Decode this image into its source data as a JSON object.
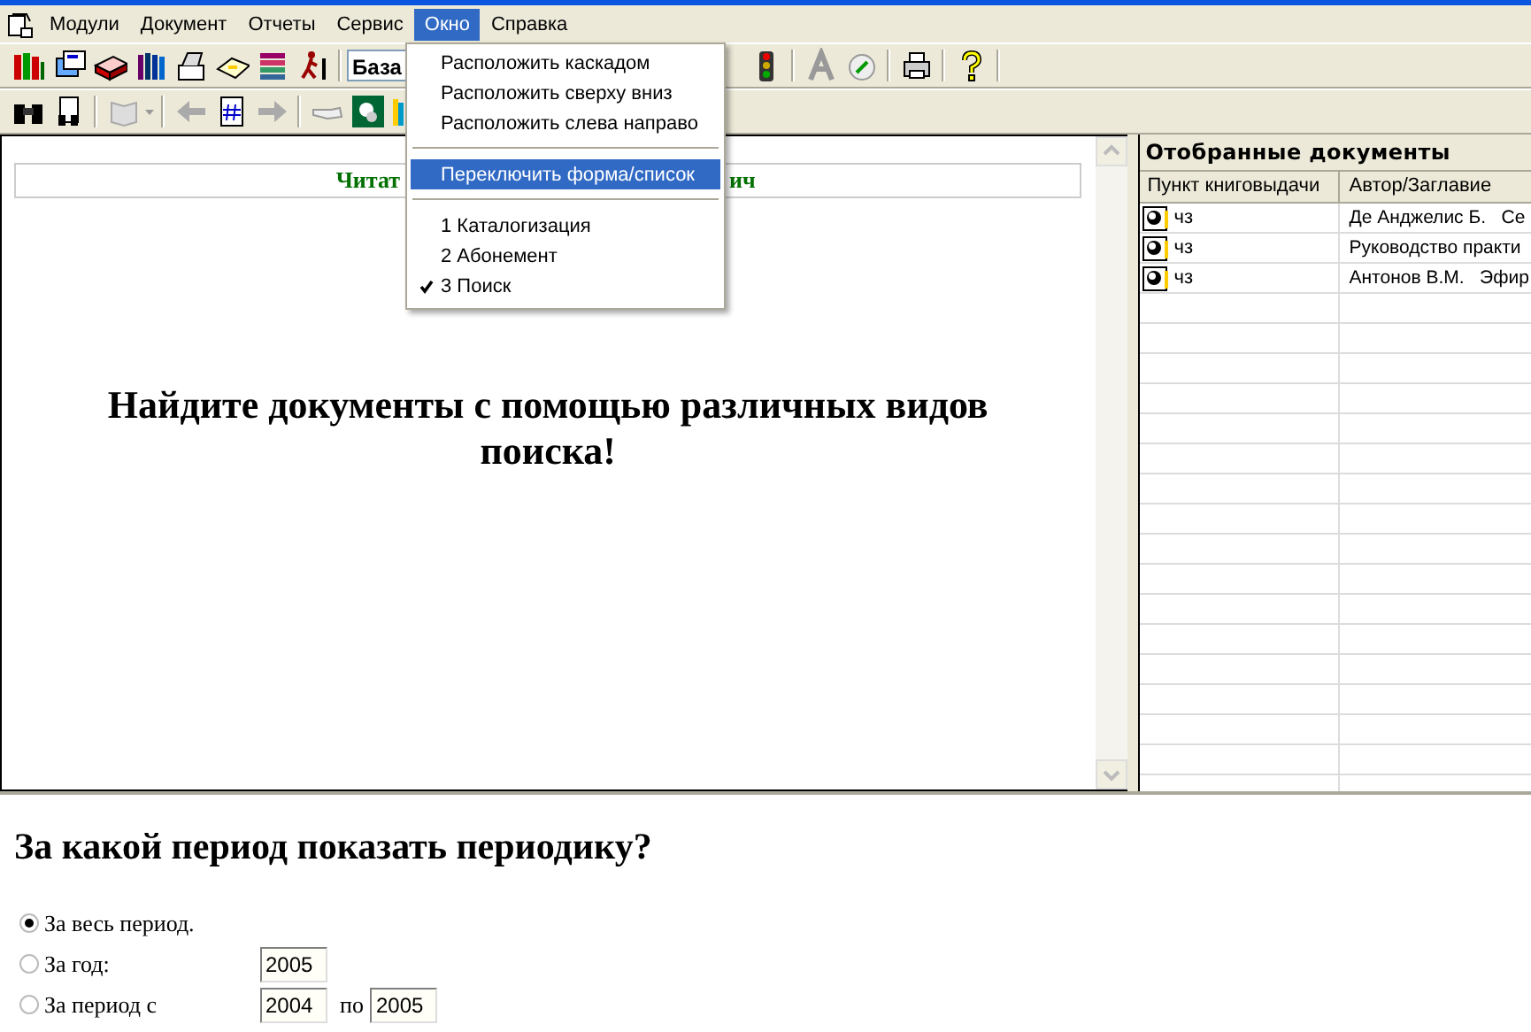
{
  "menu_bar": {
    "items": [
      {
        "label": "Модули",
        "selected": false
      },
      {
        "label": "Документ",
        "selected": false
      },
      {
        "label": "Отчеты",
        "selected": false
      },
      {
        "label": "Сервис",
        "selected": false
      },
      {
        "label": "Окно",
        "selected": true
      },
      {
        "label": "Справка",
        "selected": false
      }
    ]
  },
  "toolbar": {
    "combo_value": "База"
  },
  "window_menu": {
    "items": [
      {
        "kind": "item",
        "label": "Расположить каскадом",
        "selected": false,
        "checked": false
      },
      {
        "kind": "item",
        "label": "Расположить сверху вниз",
        "selected": false,
        "checked": false
      },
      {
        "kind": "item",
        "label": "Расположить слева направо",
        "selected": false,
        "checked": false
      },
      {
        "kind": "separator"
      },
      {
        "kind": "item",
        "label": "Переключить форма/список",
        "selected": true,
        "checked": false
      },
      {
        "kind": "separator"
      },
      {
        "kind": "item",
        "label": "1 Каталогизация",
        "selected": false,
        "checked": false
      },
      {
        "kind": "item",
        "label": "2 Абонемент",
        "selected": false,
        "checked": false
      },
      {
        "kind": "item",
        "label": "3 Поиск",
        "selected": false,
        "checked": true
      }
    ]
  },
  "search_pane": {
    "banner_parts": [
      "Читат",
      "ич"
    ],
    "heading": "Найдите документы с помощью различных видов поиска!"
  },
  "selected_documents": {
    "title": "Отобранные документы",
    "columns": [
      "Пункт книговыдачи",
      "Автор/Заглавие"
    ],
    "rows": [
      {
        "point": "чз",
        "author_title": "Де Анджелис Б.   Се"
      },
      {
        "point": "чз",
        "author_title": "Руководство практи"
      },
      {
        "point": "чз",
        "author_title": "Антонов В.М.   Эфир"
      }
    ]
  },
  "period_form": {
    "question": "За какой период показать периодику?",
    "options": [
      {
        "kind": "all",
        "label": "За весь период.",
        "selected": true
      },
      {
        "kind": "year",
        "label": "За год:",
        "selected": false,
        "value": "2005"
      },
      {
        "kind": "range",
        "label": "За период с",
        "selected": false,
        "from": "2004",
        "joiner": "по",
        "to": "2005"
      }
    ]
  }
}
